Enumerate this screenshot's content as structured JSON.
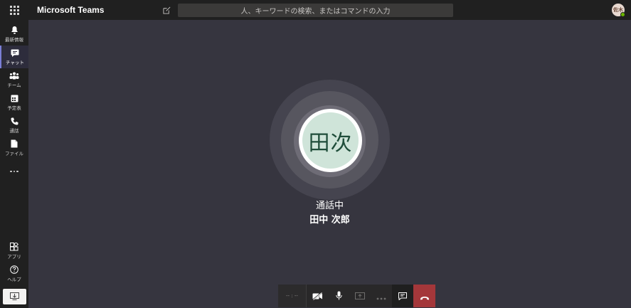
{
  "app": {
    "title": "Microsoft Teams"
  },
  "search": {
    "placeholder": "人、キーワードの検索、またはコマンドの入力"
  },
  "user": {
    "initials": "佐木"
  },
  "rail": {
    "items": [
      {
        "label": "最新情報",
        "icon": "bell-icon"
      },
      {
        "label": "チャット",
        "icon": "chat-icon",
        "active": true
      },
      {
        "label": "チーム",
        "icon": "teams-icon"
      },
      {
        "label": "予定表",
        "icon": "calendar-icon"
      },
      {
        "label": "通話",
        "icon": "phone-icon"
      },
      {
        "label": "ファイル",
        "icon": "file-icon"
      }
    ],
    "apps_label": "アプリ",
    "help_label": "ヘルプ"
  },
  "call": {
    "avatar_initials": "田次",
    "status": "通話中",
    "name": "田中 次郎"
  },
  "controls": {
    "timer_text": "-- : --"
  },
  "colors": {
    "accent": "#7b7fd6",
    "hangup": "#a4373a",
    "presence": "#6bb700"
  }
}
